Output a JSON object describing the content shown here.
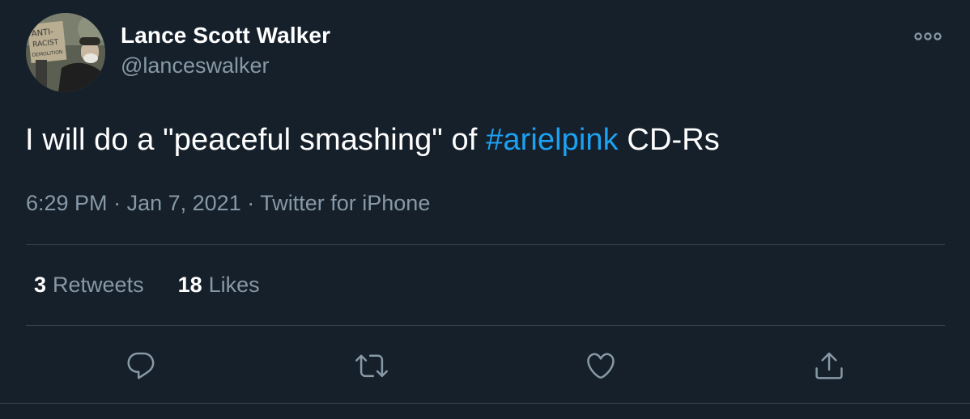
{
  "author": {
    "display_name": "Lance Scott Walker",
    "handle": "@lanceswalker",
    "avatar_sign_text": "ANTI- RACIST DEMOLITION"
  },
  "tweet": {
    "text_before": "I will do a \"peaceful smashing\" of ",
    "hashtag": "#arielpink",
    "text_after": " CD-Rs",
    "time": "6:29 PM",
    "separator": "·",
    "date": "Jan 7, 2021",
    "source": "Twitter for iPhone"
  },
  "stats": {
    "retweets_count": "3",
    "retweets_label": "Retweets",
    "likes_count": "18",
    "likes_label": "Likes"
  },
  "icons": {
    "more": "more-options-icon",
    "reply": "reply-icon",
    "retweet": "retweet-icon",
    "like": "like-icon",
    "share": "share-icon"
  },
  "colors": {
    "background": "#15202b",
    "text_primary": "#ffffff",
    "text_secondary": "#8899a6",
    "accent": "#1da1f2",
    "divider": "#38444d"
  }
}
